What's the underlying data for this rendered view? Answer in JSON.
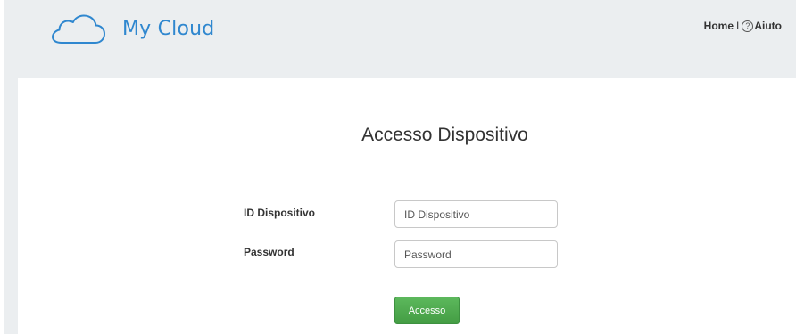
{
  "header": {
    "brand_name": "My Cloud",
    "logo_icon": "cloud-icon",
    "nav": {
      "home_label": "Home",
      "separator": "I",
      "help_label": "Aiuto",
      "help_icon": "question-circle-icon"
    }
  },
  "form": {
    "title": "Accesso Dispositivo",
    "device_id": {
      "label": "ID Dispositivo",
      "value": "",
      "placeholder": "ID Dispositivo"
    },
    "password": {
      "label": "Password",
      "value": "",
      "placeholder": "Password"
    },
    "submit_label": "Accesso"
  },
  "colors": {
    "brand": "#2f87cf",
    "header_bg": "#ebeef0",
    "button_green": "#4cae4c"
  }
}
